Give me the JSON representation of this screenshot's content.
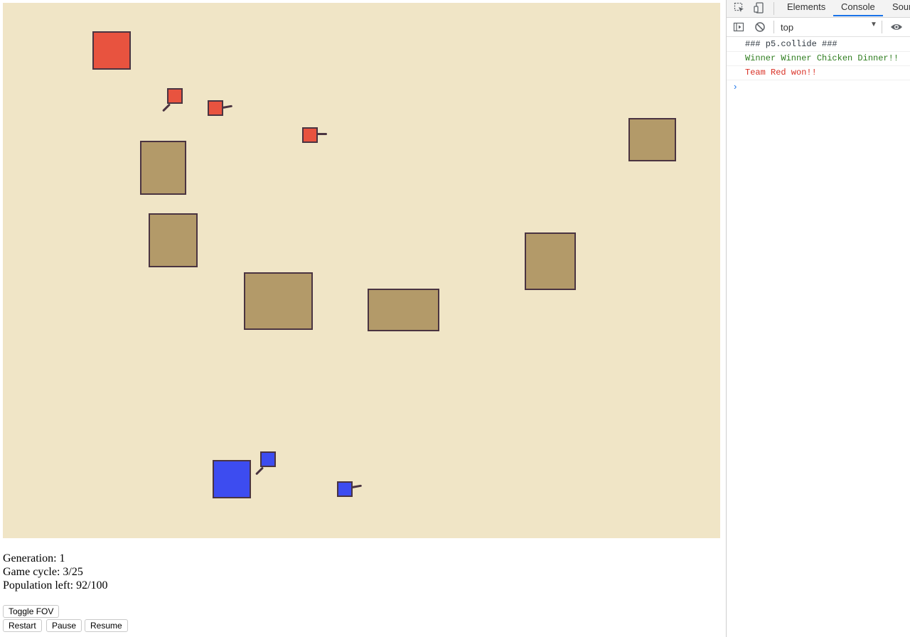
{
  "game": {
    "stats": {
      "generation": "Generation: 1",
      "game_cycle": "Game cycle: 3/25",
      "population": "Population left: 92/100"
    },
    "buttons": {
      "toggle_fov": "Toggle FOV",
      "restart": "Restart",
      "pause": "Pause",
      "resume": "Resume"
    },
    "colors": {
      "field": "#f0e5c6",
      "obstacle": "#b39a69",
      "outline": "#4a3441",
      "team_red": "#e8533f",
      "team_blue": "#3d4cf0"
    }
  },
  "devtools": {
    "tabs": [
      "Elements",
      "Console",
      "Sour"
    ],
    "active_tab": "Console",
    "context": "top",
    "console_lines": [
      {
        "text": "### p5.collide ###",
        "color": "#303942"
      },
      {
        "text": "Winner Winner Chicken Dinner!!",
        "color": "#2e7d1e"
      },
      {
        "text": "Team Red won!!",
        "color": "#d93025"
      }
    ],
    "prompt_symbol": "›",
    "icons": [
      "inspect-icon",
      "device-toolbar-icon",
      "sidebar-toggle-icon",
      "clear-console-icon",
      "dropdown-arrow-icon",
      "eye-icon"
    ]
  }
}
